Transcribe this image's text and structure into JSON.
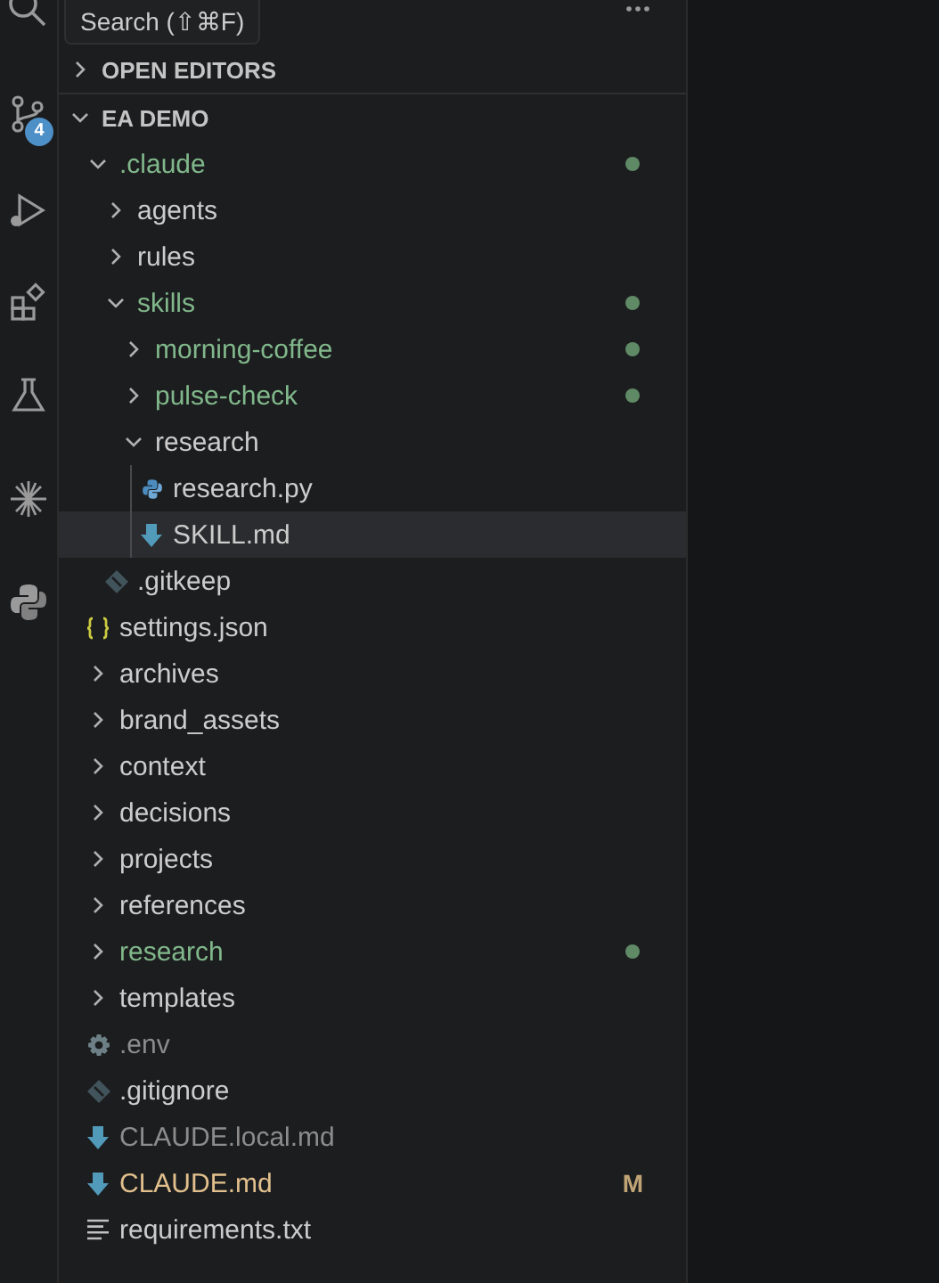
{
  "tooltip": "Search (⇧⌘F)",
  "activity_bar": [
    {
      "kind": "search"
    },
    {
      "kind": "source-control",
      "badge": "4"
    },
    {
      "kind": "run"
    },
    {
      "kind": "extensions"
    },
    {
      "kind": "testing"
    },
    {
      "kind": "sparkle"
    },
    {
      "kind": "python"
    }
  ],
  "sections": [
    {
      "title": "OPEN EDITORS",
      "expanded": false
    },
    {
      "title": "EA DEMO",
      "expanded": true,
      "tree": [
        {
          "label": ".claude",
          "kind": "folder",
          "expanded": true,
          "color": "#81b88b",
          "dot": true,
          "selected": false,
          "children": [
            {
              "label": "agents",
              "kind": "folder",
              "expanded": false,
              "selected": false
            },
            {
              "label": "rules",
              "kind": "folder",
              "expanded": false,
              "selected": false
            },
            {
              "label": "skills",
              "kind": "folder",
              "expanded": true,
              "color": "#81b88b",
              "dot": true,
              "selected": false,
              "children": [
                {
                  "label": "morning-coffee",
                  "kind": "folder",
                  "expanded": false,
                  "color": "#81b88b",
                  "dot": true,
                  "selected": false
                },
                {
                  "label": "pulse-check",
                  "kind": "folder",
                  "expanded": false,
                  "color": "#81b88b",
                  "dot": true,
                  "selected": false
                },
                {
                  "label": "research",
                  "kind": "folder",
                  "expanded": true,
                  "selected": false,
                  "children": [
                    {
                      "label": "research.py",
                      "kind": "python",
                      "selected": false
                    },
                    {
                      "label": "SKILL.md",
                      "kind": "markdown",
                      "selected": true
                    }
                  ]
                }
              ]
            },
            {
              "label": ".gitkeep",
              "kind": "git",
              "selected": false
            }
          ]
        },
        {
          "label": "settings.json",
          "kind": "json",
          "selected": false
        },
        {
          "label": "archives",
          "kind": "folder",
          "expanded": false,
          "selected": false
        },
        {
          "label": "brand_assets",
          "kind": "folder",
          "expanded": false,
          "selected": false
        },
        {
          "label": "context",
          "kind": "folder",
          "expanded": false,
          "selected": false
        },
        {
          "label": "decisions",
          "kind": "folder",
          "expanded": false,
          "selected": false
        },
        {
          "label": "projects",
          "kind": "folder",
          "expanded": false,
          "selected": false
        },
        {
          "label": "references",
          "kind": "folder",
          "expanded": false,
          "selected": false
        },
        {
          "label": "research",
          "kind": "folder",
          "expanded": false,
          "color": "#81b88b",
          "dot": true,
          "selected": false
        },
        {
          "label": "templates",
          "kind": "folder",
          "expanded": false,
          "selected": false
        },
        {
          "label": ".env",
          "kind": "settings",
          "color": "#8c8c8c",
          "selected": false
        },
        {
          "label": ".gitignore",
          "kind": "git",
          "selected": false
        },
        {
          "label": "CLAUDE.local.md",
          "kind": "markdown",
          "color": "#8c8c8c",
          "selected": false
        },
        {
          "label": "CLAUDE.md",
          "kind": "markdown",
          "color": "#e2c08d",
          "badge": "M",
          "selected": false
        },
        {
          "label": "requirements.txt",
          "kind": "text",
          "selected": false
        }
      ]
    }
  ]
}
